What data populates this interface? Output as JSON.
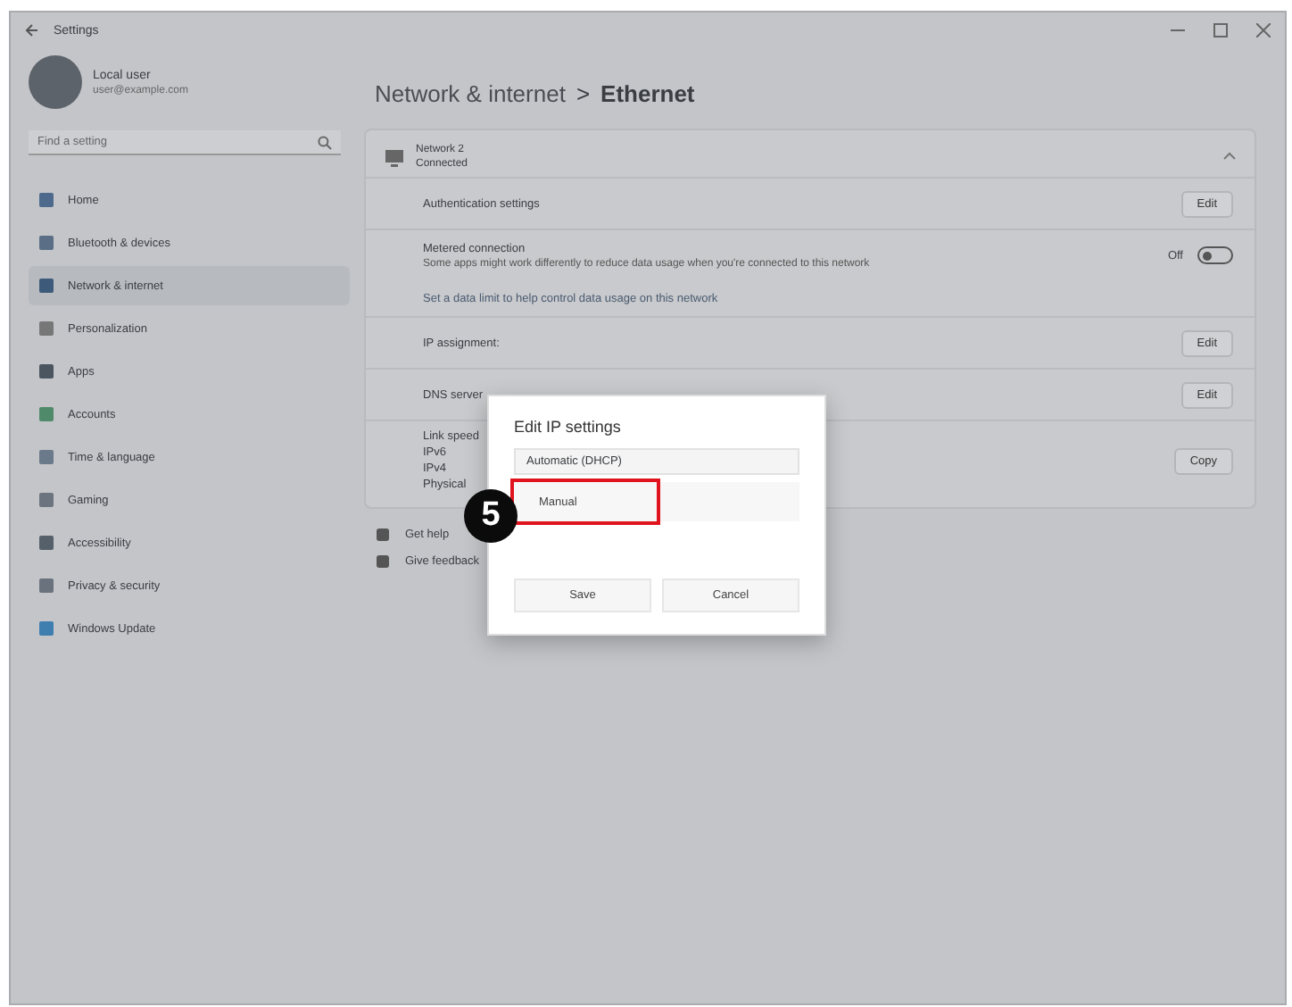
{
  "window": {
    "title": "Settings"
  },
  "user": {
    "name": "Local user",
    "email": "user@example.com"
  },
  "search": {
    "placeholder": "Find a setting"
  },
  "sidebar": {
    "items": [
      {
        "label": "Home",
        "selected": false
      },
      {
        "label": "Bluetooth & devices",
        "selected": false
      },
      {
        "label": "Network & internet",
        "selected": true
      },
      {
        "label": "Personalization",
        "selected": false
      },
      {
        "label": "Apps",
        "selected": false
      },
      {
        "label": "Accounts",
        "selected": false
      },
      {
        "label": "Time & language",
        "selected": false
      },
      {
        "label": "Gaming",
        "selected": false
      },
      {
        "label": "Accessibility",
        "selected": false
      },
      {
        "label": "Privacy & security",
        "selected": false
      },
      {
        "label": "Windows Update",
        "selected": false
      }
    ]
  },
  "breadcrumb": {
    "parent": "Network & internet",
    "separator": ">",
    "current": "Ethernet"
  },
  "adapter": {
    "name": "Network 2",
    "status": "Connected"
  },
  "rows": [
    {
      "kind": "button",
      "label": "Authentication settings",
      "action": "Edit"
    },
    {
      "kind": "toggle",
      "label": "Metered connection",
      "description": "Some apps might work differently to reduce data usage when you're connected to this network",
      "state": "Off",
      "on": false
    },
    {
      "kind": "link",
      "label": "Set a data limit to help control data usage on this network"
    },
    {
      "kind": "button",
      "label": "IP assignment:",
      "action": "Edit"
    },
    {
      "kind": "button",
      "label": "DNS server",
      "action": "Edit"
    },
    {
      "kind": "details",
      "label": "Link speed",
      "lines": [
        "IPv6",
        "IPv4",
        "Physical"
      ],
      "action": "Copy"
    }
  ],
  "footer": [
    {
      "label": "Get help"
    },
    {
      "label": "Give feedback"
    }
  ],
  "dialog": {
    "title": "Edit IP settings",
    "dropdown": "Automatic (DHCP)",
    "option": "Manual",
    "buttons": [
      "Save",
      "Cancel"
    ]
  },
  "callout": {
    "number": "5"
  }
}
